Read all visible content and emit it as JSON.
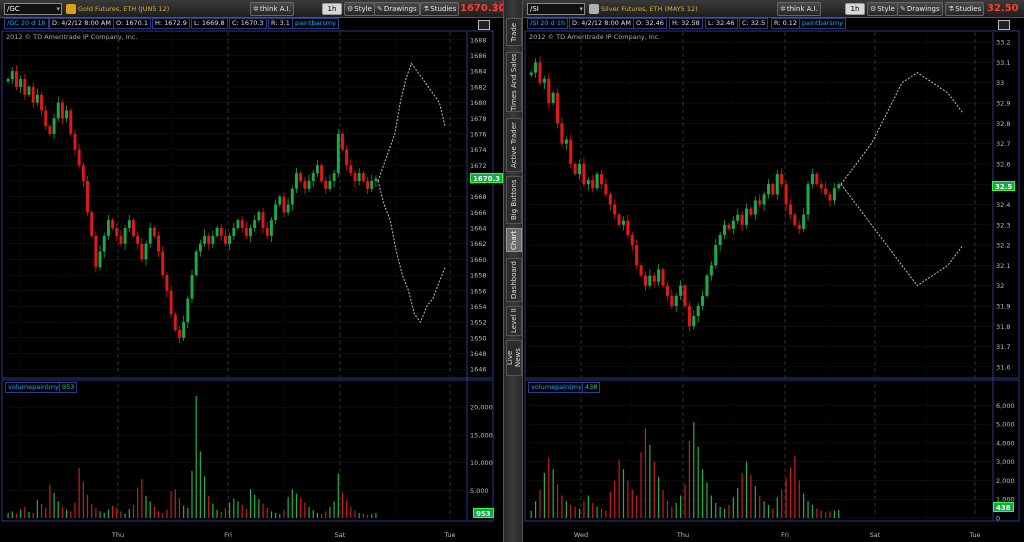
{
  "colors": {
    "up": "#1ea84a",
    "down": "#e01818",
    "projection": "#bdbdbd",
    "volume_up": "#22b14c",
    "volume_down": "#c81e1e",
    "grid": "#2d2d2d",
    "border": "#2b3a8a",
    "price_tag_bg": "#12a84a",
    "last_price": "#ff3b30"
  },
  "side_tabs": [
    {
      "label": "Trade",
      "active": false
    },
    {
      "label": "Times And Sales",
      "active": false
    },
    {
      "label": "Active Trader",
      "active": false
    },
    {
      "label": "Big Buttons",
      "active": false
    },
    {
      "label": "Chart",
      "active": true
    },
    {
      "label": "Dashboard",
      "active": false
    },
    {
      "label": "Level II",
      "active": false
    },
    {
      "label": "Live News",
      "active": false
    }
  ],
  "panels": [
    {
      "id": "gold",
      "toolbar": {
        "symbol": "/GC",
        "instrument": "Gold Futures, ETH (JUN5 12)",
        "think_label": "think A.I.",
        "timeframe": "1h",
        "style_label": "Style",
        "drawings_label": "Drawings",
        "studies_label": "Studies",
        "last_price": "1670.30",
        "change_top": "-4.10",
        "change_bottom": "-0.25%"
      },
      "infobar": {
        "symbol_period": "/GC 20 d 1h",
        "date": "D: 4/2/12 8:00 AM",
        "open": "O: 1670.1",
        "high": "H: 1672.9",
        "low": "L: 1669.8",
        "close": "C: 1670.3",
        "range": "R: 3.1",
        "study": "paintbarsmy"
      },
      "copyright": "2012 © TD Ameritrade IP Company, Inc.",
      "price_tag": "1670.3",
      "volume_study": "volumepaintmy",
      "volume_value": "953",
      "volume_tag": "953"
    },
    {
      "id": "silver",
      "toolbar": {
        "symbol": "/SI",
        "instrument": "Silver Futures, ETH (MAY5 12)",
        "think_label": "think A.I.",
        "timeframe": "1h",
        "style_label": "Style",
        "drawings_label": "Drawings",
        "studies_label": "Studies",
        "last_price": "32.50"
      },
      "infobar": {
        "symbol_period": "/SI 20 d 1h",
        "date": "D: 4/2/12 8:00 AM",
        "open": "O: 32.46",
        "high": "H: 32.58",
        "low": "L: 32.46",
        "close": "C: 32.5",
        "range": "R: 0.12",
        "study": "paintbarsmy"
      },
      "copyright": "2012 © TD Ameritrade IP Company, Inc.",
      "price_tag": "32.5",
      "volume_study": "volumepaintmy",
      "volume_value": "438",
      "volume_tag": "438"
    }
  ],
  "chart_data": [
    {
      "type": "candlestick",
      "symbol": "/GC",
      "interval": "1h",
      "ylim": [
        1645,
        1689
      ],
      "y_ticks": [
        "1688",
        "1686",
        "1684",
        "1682",
        "1680",
        "1678",
        "1676",
        "1674",
        "1672",
        "1670",
        "1668",
        "1666",
        "1664",
        "1662",
        "1660",
        "1658",
        "1656",
        "1654",
        "1652",
        "1650",
        "1648",
        "1646"
      ],
      "day_labels": [
        "Thu",
        "Fri",
        "Sat",
        "Tue"
      ],
      "closes": [
        1683,
        1684,
        1682,
        1683,
        1681,
        1682,
        1680,
        1681,
        1679,
        1677,
        1676,
        1678,
        1680,
        1678,
        1679,
        1676,
        1674,
        1672,
        1670,
        1666,
        1663,
        1659,
        1661,
        1663,
        1665,
        1664,
        1663,
        1662,
        1664,
        1665,
        1663,
        1662,
        1660,
        1662,
        1664,
        1663,
        1661,
        1658,
        1656,
        1653,
        1651,
        1650,
        1652,
        1655,
        1658,
        1661,
        1662,
        1663,
        1662,
        1663,
        1664,
        1663,
        1662,
        1663,
        1664,
        1665,
        1664,
        1663,
        1664,
        1665,
        1666,
        1664,
        1663,
        1665,
        1667,
        1668,
        1666,
        1667,
        1669,
        1671,
        1670,
        1669,
        1670,
        1671,
        1672,
        1670,
        1669,
        1670,
        1671,
        1676,
        1674,
        1672,
        1671,
        1670,
        1671,
        1670,
        1669,
        1670,
        1670.3
      ],
      "projection_upper": [
        1670,
        1672,
        1674,
        1676,
        1680,
        1683,
        1685,
        1684,
        1683,
        1682,
        1681,
        1680,
        1677
      ],
      "projection_lower": [
        1670,
        1667,
        1665,
        1661,
        1658,
        1656,
        1653,
        1652,
        1654,
        1655,
        1657,
        1659
      ],
      "volume": {
        "ylim": [
          0,
          22000
        ],
        "y_ticks": [
          "20,000",
          "15,000",
          "10,000",
          "5,000"
        ],
        "values": [
          900,
          1200,
          800,
          1500,
          2000,
          1100,
          900,
          3200,
          2500,
          1800,
          6000,
          4500,
          3000,
          2000,
          1500,
          1200,
          2800,
          9000,
          6500,
          4200,
          2500,
          1800,
          1200,
          900,
          1500,
          2200,
          1900,
          1200,
          800,
          1600,
          2400,
          5500,
          7000,
          4000,
          3000,
          2000,
          1200,
          900,
          1500,
          4800,
          5200,
          3600,
          2200,
          1800,
          8500,
          22000,
          12000,
          7500,
          4000,
          2600,
          1500,
          1100,
          1800,
          2800,
          3500,
          3000,
          2400,
          1600,
          5200,
          4200,
          3400,
          2600,
          1800,
          1200,
          900,
          700,
          1400,
          3800,
          5200,
          4400,
          3600,
          2800,
          2000,
          1400,
          900,
          700,
          1200,
          2000,
          3000,
          8000,
          4600,
          3200,
          2000,
          1400,
          900,
          800,
          600,
          700,
          953
        ]
      }
    },
    {
      "type": "candlestick",
      "symbol": "/SI",
      "interval": "1h",
      "ylim": [
        31.55,
        33.25
      ],
      "y_ticks": [
        "33.2",
        "33.1",
        "33",
        "32.9",
        "32.8",
        "32.7",
        "32.6",
        "32.5",
        "32.4",
        "32.3",
        "32.2",
        "32.1",
        "32",
        "31.9",
        "31.8",
        "31.7",
        "31.6"
      ],
      "day_labels": [
        "Wed",
        "Thu",
        "Fri",
        "Sat",
        "Tue"
      ],
      "closes": [
        33.05,
        33.1,
        33.0,
        33.02,
        32.9,
        32.95,
        32.8,
        32.7,
        32.72,
        32.6,
        32.55,
        32.6,
        32.5,
        32.52,
        32.48,
        32.55,
        32.5,
        32.45,
        32.4,
        32.35,
        32.3,
        32.32,
        32.25,
        32.2,
        32.1,
        32.05,
        32.0,
        32.05,
        32.02,
        32.08,
        32.0,
        31.95,
        31.9,
        31.95,
        32.0,
        31.9,
        31.8,
        31.85,
        31.9,
        31.95,
        32.05,
        32.1,
        32.2,
        32.25,
        32.3,
        32.28,
        32.32,
        32.35,
        32.3,
        32.38,
        32.35,
        32.42,
        32.4,
        32.45,
        32.5,
        32.45,
        32.55,
        32.5,
        32.4,
        32.35,
        32.3,
        32.28,
        32.35,
        32.5,
        32.55,
        32.5,
        32.48,
        32.45,
        32.42,
        32.48,
        32.5
      ],
      "projection_upper": [
        32.5,
        32.6,
        32.7,
        32.85,
        33.0,
        33.05,
        33.0,
        32.95,
        32.85
      ],
      "projection_lower": [
        32.5,
        32.4,
        32.3,
        32.2,
        32.1,
        32.0,
        32.05,
        32.1,
        32.2
      ],
      "volume": {
        "ylim": [
          0,
          6500
        ],
        "y_ticks": [
          "6,000",
          "5,000",
          "4,000",
          "3,000",
          "2,000",
          "1,000",
          "0"
        ],
        "values": [
          400,
          900,
          1500,
          2400,
          3200,
          2600,
          1800,
          1200,
          900,
          700,
          600,
          500,
          900,
          1200,
          800,
          600,
          500,
          400,
          1400,
          2000,
          3100,
          2600,
          2000,
          1500,
          1200,
          3500,
          4800,
          3900,
          3000,
          2200,
          1500,
          900,
          600,
          800,
          1200,
          1800,
          4100,
          5100,
          3800,
          2600,
          1900,
          1200,
          800,
          600,
          500,
          700,
          1100,
          1600,
          2400,
          3000,
          2300,
          1700,
          1200,
          900,
          700,
          500,
          1100,
          1500,
          2100,
          2700,
          3300,
          2000,
          1300,
          900,
          700,
          500,
          400,
          300,
          350,
          400,
          438
        ]
      }
    }
  ]
}
